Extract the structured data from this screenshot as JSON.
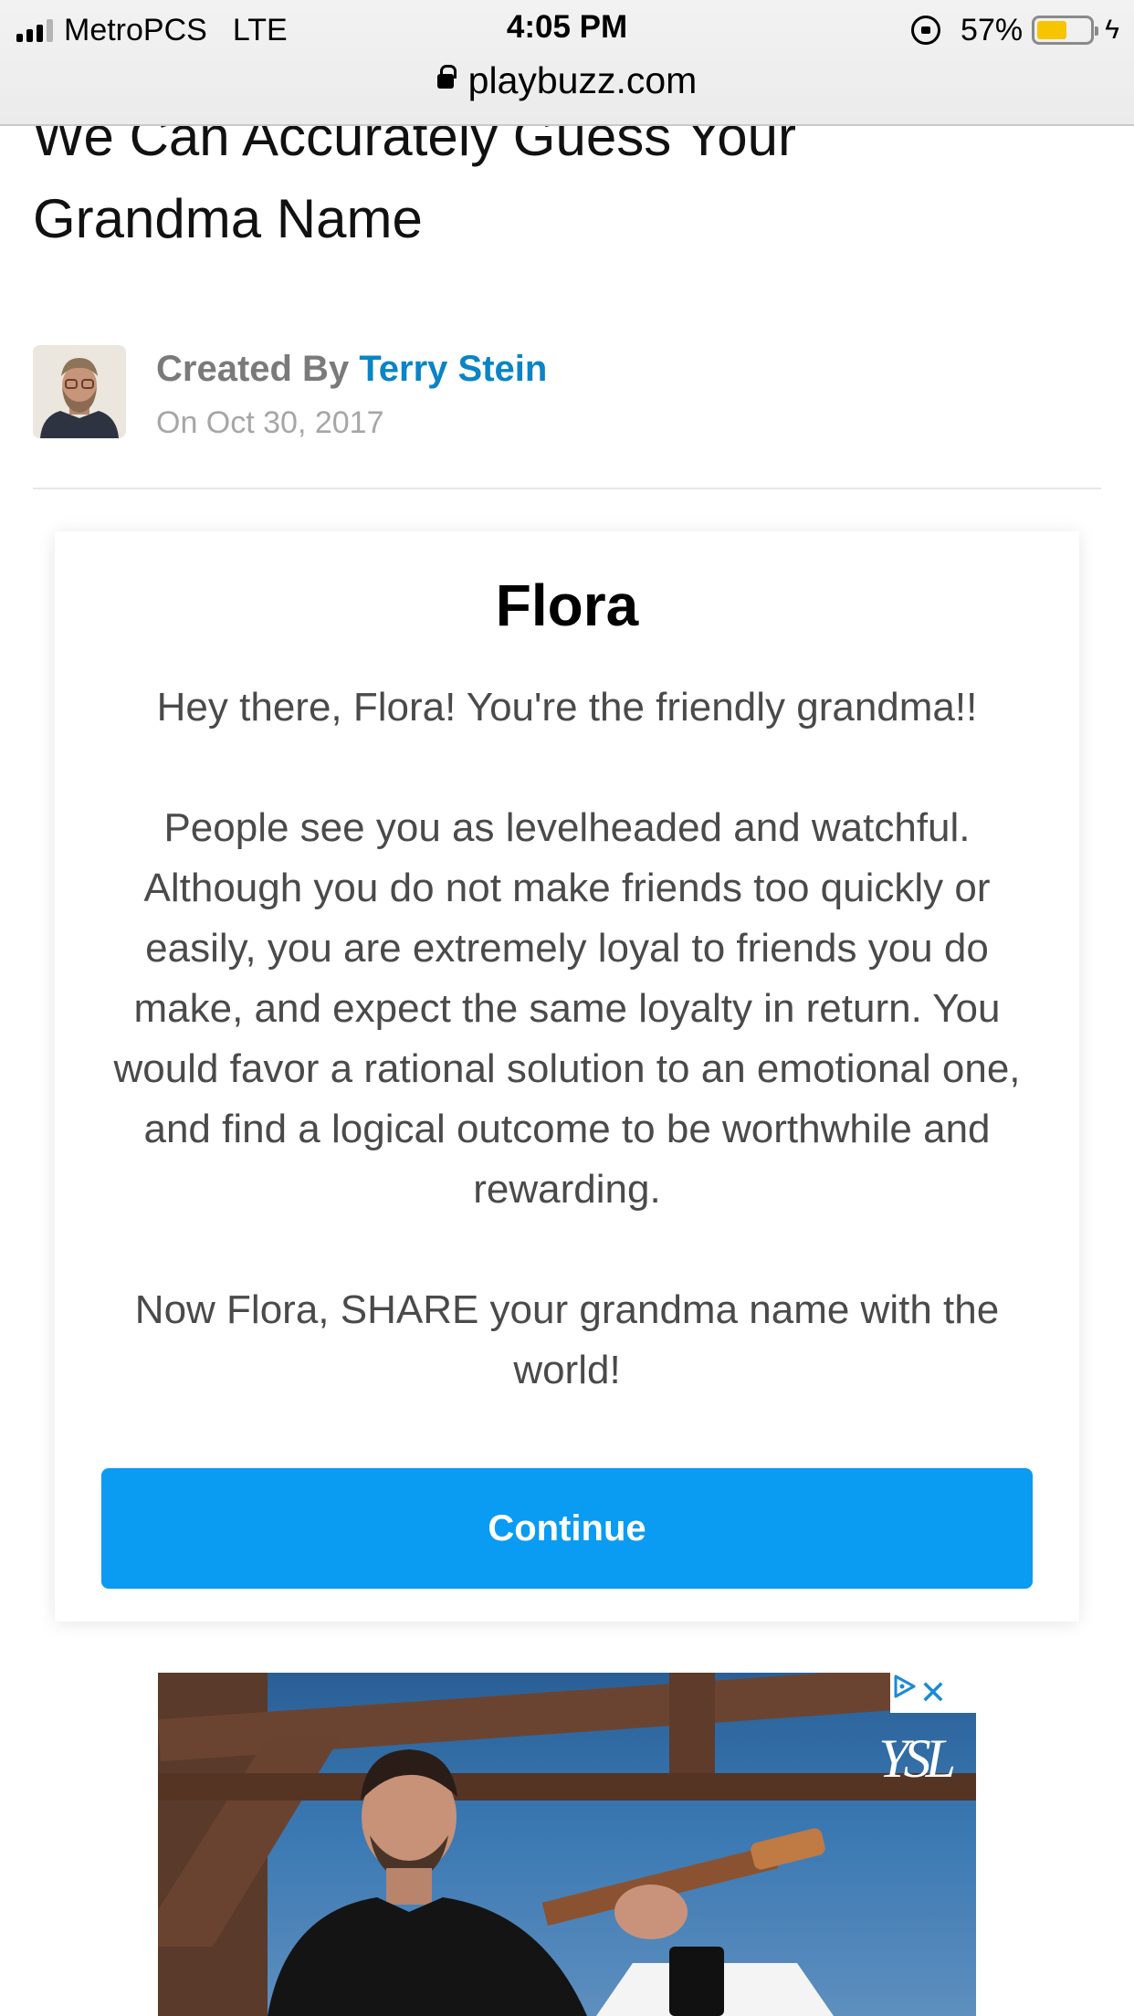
{
  "status_bar": {
    "carrier": "MetroPCS",
    "network": "LTE",
    "time": "4:05 PM",
    "battery_percent": "57%",
    "battery_level": 0.57,
    "url": "playbuzz.com"
  },
  "article": {
    "title": "We Can Accurately Guess Your Grandma Name",
    "created_by_label": "Created By",
    "author_name": "Terry Stein",
    "date": "On Oct 30, 2017"
  },
  "result": {
    "name": "Flora",
    "paragraph_1": "Hey there, Flora! You're the friendly grandma!!",
    "paragraph_2": "People see you as levelheaded and watchful. Although you do not make friends too quickly or easily, you are extremely loyal to friends you do make, and expect the same loyalty in return. You would favor a rational solution to an emotional one, and find a logical outcome to be worthwhile and rewarding.",
    "paragraph_3": "Now Flora, SHARE your grandma name with the world!",
    "continue_label": "Continue"
  },
  "ad": {
    "close_symbol": "✕",
    "logo_text": "YSL"
  },
  "colors": {
    "link": "#0a84c6",
    "button": "#0a9bf2",
    "battery": "#f7c500"
  }
}
